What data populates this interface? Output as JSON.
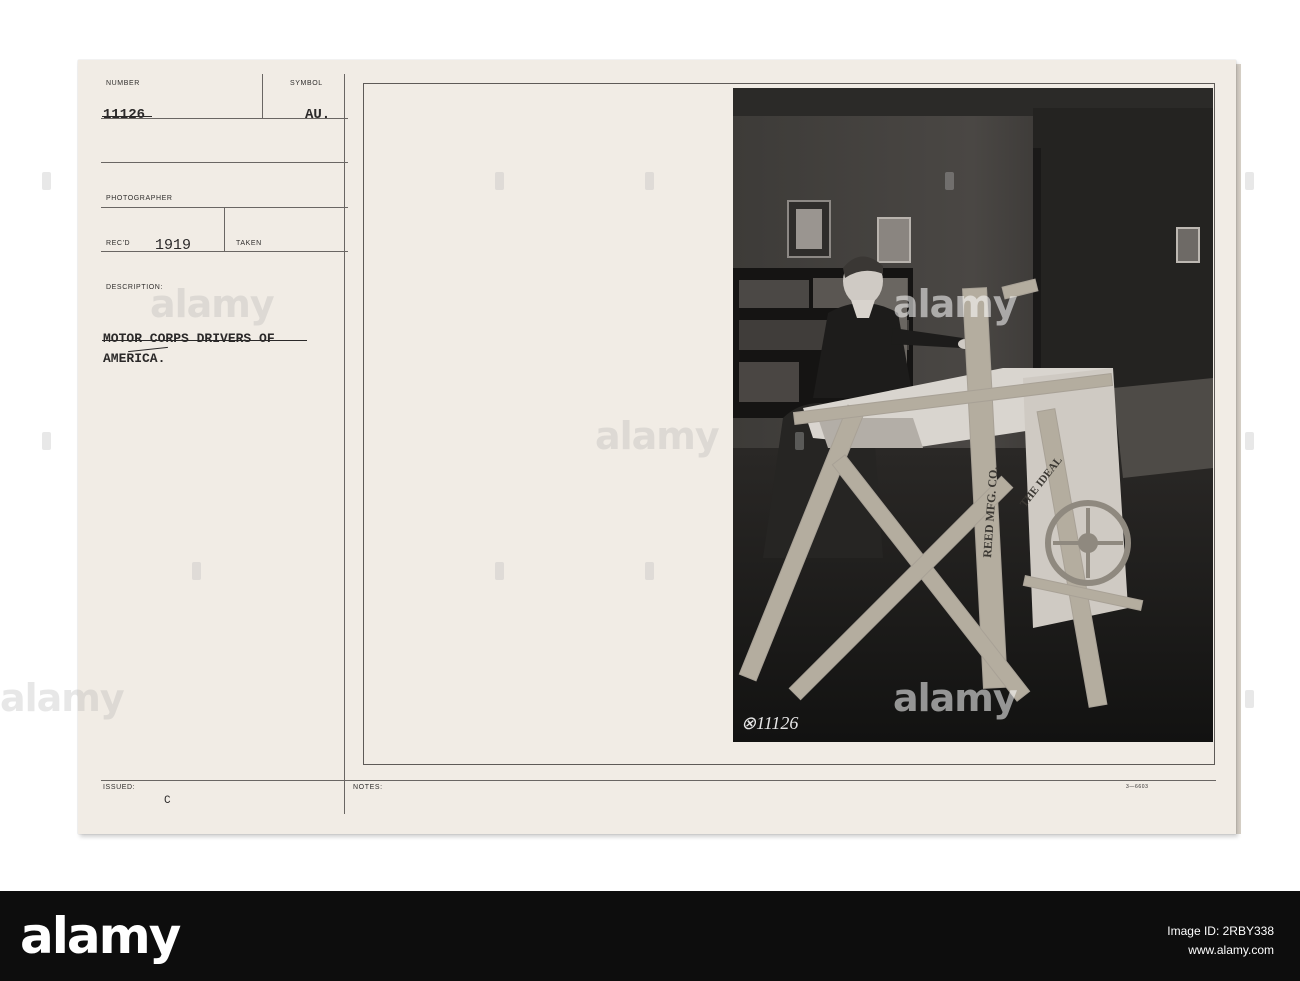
{
  "record": {
    "number_label": "NUMBER",
    "number_value": "11126",
    "symbol_label": "SYMBOL",
    "symbol_value": "AU.",
    "photographer_label": "PHOTOGRAPHER",
    "recd_label": "REC'D",
    "recd_value": "1919",
    "taken_label": "TAKEN",
    "description_label": "DESCRIPTION:",
    "description_line1": "MOTOR CORPS DRIVERS OF",
    "description_line2": "AMERICA.",
    "issued_label": "ISSUED:",
    "issued_value": "C",
    "notes_label": "NOTES:",
    "form_code": "3—6603"
  },
  "photo": {
    "number": "⊗11126",
    "loom_text_1": "REED MFG. CO.",
    "loom_text_2": "THE IDEAL"
  },
  "watermark": {
    "text": "alamy"
  },
  "footer": {
    "logo": "alamy",
    "image_id_line": "Image ID: 2RBY338",
    "site_line": "www.alamy.com"
  }
}
